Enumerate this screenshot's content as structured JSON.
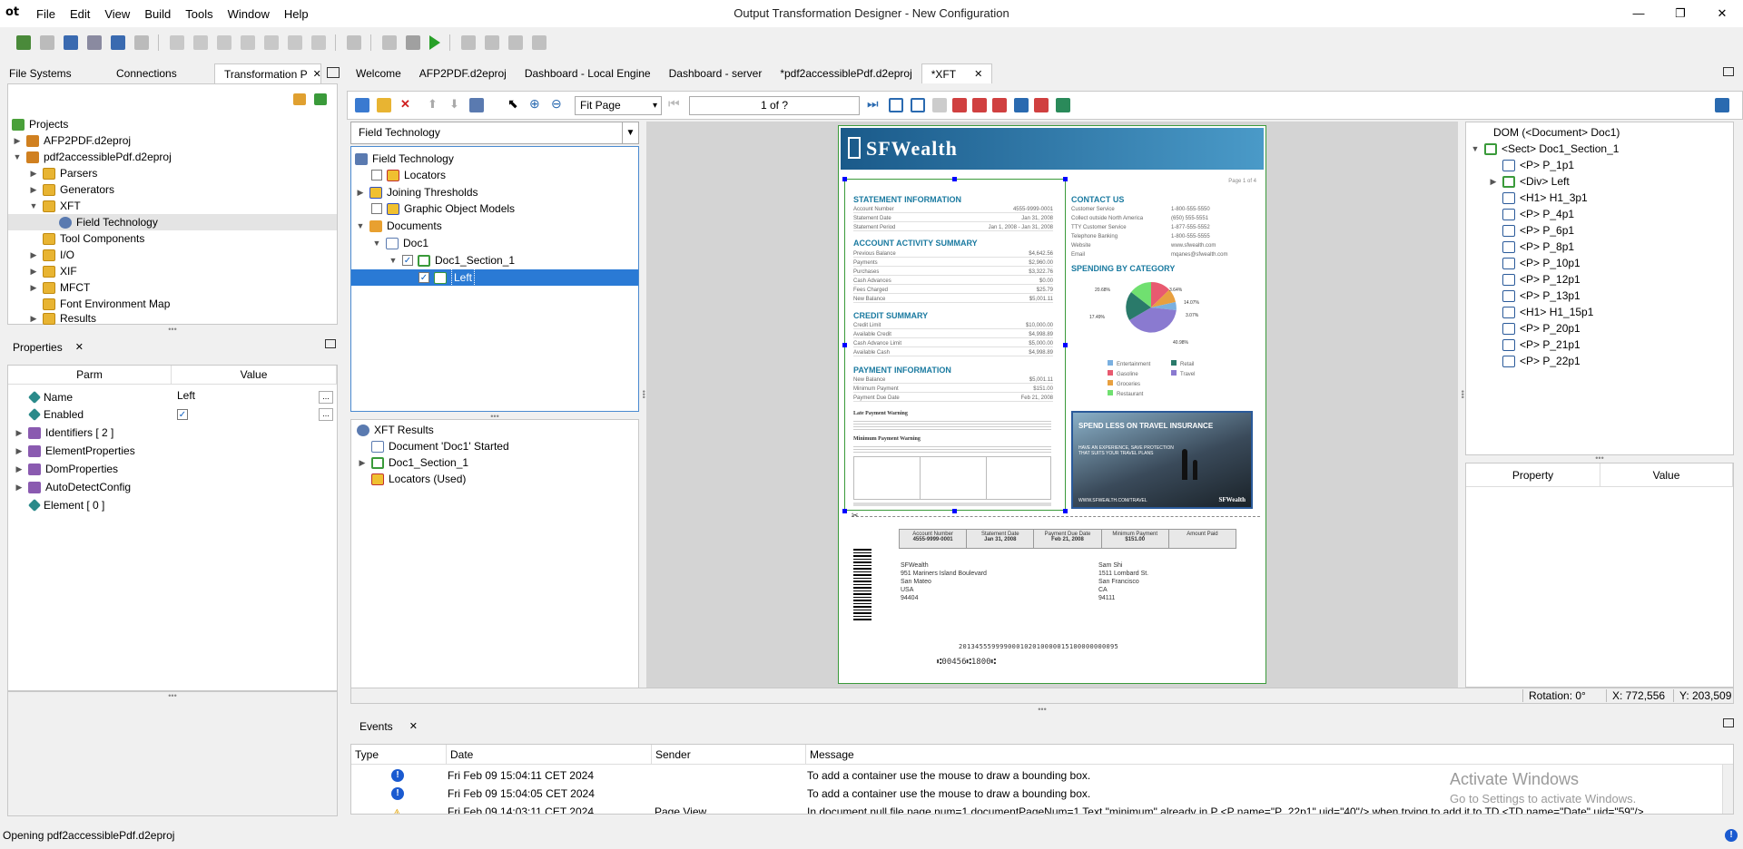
{
  "app": {
    "logo": "ot",
    "title": "Output Transformation Designer - New Configuration",
    "menu": [
      "File",
      "Edit",
      "View",
      "Build",
      "Tools",
      "Window",
      "Help"
    ],
    "win_min": "—",
    "win_max": "❐",
    "win_close": "✕"
  },
  "left_tabs": {
    "file_systems": "File Systems",
    "connections": "Connections",
    "transformation": "Transformation P"
  },
  "projects_tree": {
    "root": "Projects",
    "items": [
      "AFP2PDF.d2eproj",
      "pdf2accessiblePdf.d2eproj",
      "Parsers",
      "Generators",
      "XFT",
      "Field Technology",
      "Tool Components",
      "I/O",
      "XIF",
      "MFCT",
      "Font Environment Map",
      "Results"
    ]
  },
  "properties": {
    "tab": "Properties",
    "col_parm": "Parm",
    "col_value": "Value",
    "rows": [
      {
        "name": "Name",
        "value": "Left"
      },
      {
        "name": "Enabled",
        "value": ""
      },
      {
        "name": "Identifiers [ 2 ]",
        "value": ""
      },
      {
        "name": "ElementProperties",
        "value": ""
      },
      {
        "name": "DomProperties",
        "value": ""
      },
      {
        "name": "AutoDetectConfig",
        "value": ""
      },
      {
        "name": "Element [ 0 ]",
        "value": ""
      }
    ],
    "ellipsis": "..."
  },
  "doc_tabs": [
    "Welcome",
    "AFP2PDF.d2eproj",
    "Dashboard - Local Engine",
    "Dashboard - server",
    "*pdf2accessiblePdf.d2eproj",
    "*XFT"
  ],
  "xft_toolbar": {
    "zoom_select": "Fit Page",
    "page_indicator": "1 of ?"
  },
  "field_tech": {
    "dropdown": "Field Technology",
    "items": [
      "Field Technology",
      "Locators",
      "Joining Thresholds",
      "Graphic Object Models",
      "Documents",
      "Doc1",
      "Doc1_Section_1",
      "Left"
    ]
  },
  "xft_results": {
    "items": [
      "XFT Results",
      "Document 'Doc1' Started",
      "Doc1_Section_1",
      "Locators (Used)"
    ]
  },
  "document": {
    "brand": "SFWealth",
    "page": "Page 1 of 4",
    "statement_info": "STATEMENT INFORMATION",
    "statement_rows": [
      [
        "Account Number",
        "4555-9999-0001"
      ],
      [
        "Statement Date",
        "Jan 31, 2008"
      ],
      [
        "Statement Period",
        "Jan 1, 2008 - Jan 31, 2008"
      ]
    ],
    "activity": "ACCOUNT ACTIVITY SUMMARY",
    "activity_rows": [
      [
        "Previous Balance",
        "$4,642.56"
      ],
      [
        "Payments",
        "$2,960.00"
      ],
      [
        "Purchases",
        "$3,322.76"
      ],
      [
        "Cash Advances",
        "$0.00"
      ],
      [
        "Fees Charged",
        "$25.79"
      ],
      [
        "New Balance",
        "$5,001.11"
      ]
    ],
    "credit": "CREDIT SUMMARY",
    "credit_rows": [
      [
        "Credit Limit",
        "$10,000.00"
      ],
      [
        "Available Credit",
        "$4,998.89"
      ],
      [
        "Cash Advance Limit",
        "$5,000.00"
      ],
      [
        "Available Cash",
        "$4,998.89"
      ]
    ],
    "payment": "PAYMENT INFORMATION",
    "payment_rows": [
      [
        "New Balance",
        "$5,001.11"
      ],
      [
        "Minimum Payment",
        "$151.00"
      ],
      [
        "Payment Due Date",
        "Feb 21, 2008"
      ]
    ],
    "contact": "CONTACT US",
    "contact_rows": [
      [
        "Customer Service",
        "1-800-555-5550"
      ],
      [
        "Collect outside North America",
        "(650) 555-5551"
      ],
      [
        "TTY Customer Service",
        "1-877-555-5552"
      ],
      [
        "Telephone Banking",
        "1-800-555-5555"
      ],
      [
        "Website",
        "www.sfwealth.com"
      ],
      [
        "Email",
        "mqanes@sfwealth.com"
      ]
    ],
    "spending": "SPENDING BY CATEGORY",
    "pie_labels": [
      "20.68%",
      "3.64%",
      "14.07%",
      "3.07%",
      "17.49%",
      "40.98%"
    ],
    "legend": [
      "Entertainment",
      "Retail",
      "Gasoline",
      "Travel",
      "Groceries",
      "Restaurant"
    ],
    "legend_colors": [
      "#7ab0e0",
      "#2a7a6a",
      "#e85a70",
      "#8a7ad0",
      "#e8a040",
      "#70e070"
    ],
    "ad_title": "SPEND LESS ON TRAVEL INSURANCE",
    "ad_sub": "HAVE AN EXPERIENCE, SAVE PROTECTION THAT SUITS YOUR TRAVEL PLANS",
    "ad_url": "WWW.SFWEALTH.COM/TRAVEL",
    "late_warning": "Late Payment Warning",
    "min_warning": "Minimum Payment Warning",
    "stub_headers": [
      [
        "Account Number",
        "4555-9999-0001"
      ],
      [
        "Statement Date",
        "Jan 31, 2008"
      ],
      [
        "Payment Due Date",
        "Feb 21, 2008"
      ],
      [
        "Minimum Payment",
        "$151.00"
      ],
      [
        "Amount Paid",
        ""
      ]
    ],
    "from_addr": [
      "SFWealth",
      "951 Mariners Island Boulevard",
      "San Mateo",
      "USA",
      "94404"
    ],
    "to_addr": [
      "Sam Shi",
      "1511 Lombard St.",
      "San Francisco",
      "CA",
      "94111"
    ],
    "micr1": "201345559999000102010000015100000000095",
    "micr2": "⑆00456⑆1800⑆"
  },
  "dom_tree": {
    "items": [
      "DOM (<Document> Doc1)",
      "<Sect> Doc1_Section_1",
      "<P> P_1p1",
      "<Div> Left",
      "<H1> H1_3p1",
      "<P> P_4p1",
      "<P> P_6p1",
      "<P> P_8p1",
      "<P> P_10p1",
      "<P> P_12p1",
      "<P> P_13p1",
      "<H1> H1_15p1",
      "<P> P_20p1",
      "<P> P_21p1",
      "<P> P_22p1"
    ]
  },
  "right_props": {
    "col_property": "Property",
    "col_value": "Value"
  },
  "viewer_status": {
    "rotation": "Rotation: 0°",
    "x": "X: 772,556",
    "y": "Y: 203,509"
  },
  "events": {
    "tab": "Events",
    "cols": [
      "Type",
      "Date",
      "Sender",
      "Message"
    ],
    "rows": [
      {
        "date": "Fri Feb 09 15:04:11 CET 2024",
        "sender": "",
        "message": "To add a container use the mouse to draw a bounding box."
      },
      {
        "date": "Fri Feb 09 15:04:05 CET 2024",
        "sender": "",
        "message": "To add a container use the mouse to draw a bounding box."
      },
      {
        "date": "Fri Feb 09 14:03:11 CET 2024",
        "sender": "Page View",
        "message": "In document null file page num=1 documentPageNum=1 Text \"minimum\" already in P <P name=\"P_22p1\" uid=\"40\"/> when trying to add it to TD <TD name=\"Date\" uid=\"59\"/>"
      }
    ]
  },
  "watermark": {
    "title": "Activate Windows",
    "sub": "Go to Settings to activate Windows."
  },
  "status_bar": "Opening pdf2accessiblePdf.d2eproj"
}
